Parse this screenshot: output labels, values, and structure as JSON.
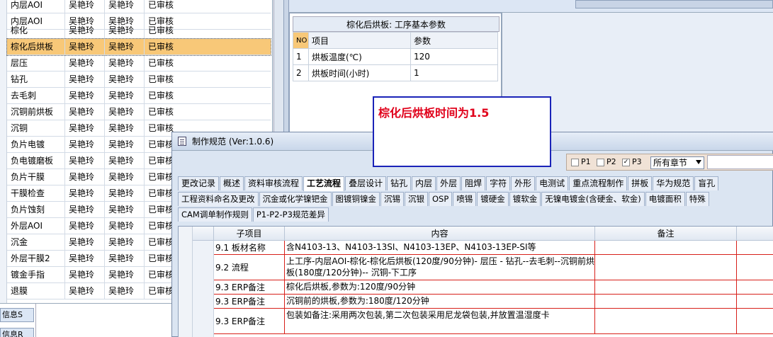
{
  "left_list": {
    "rows": [
      {
        "name": "内层AOI",
        "c1": "吴艳玲",
        "c2": "吴艳玲",
        "status": "已审核"
      },
      {
        "name": "棕化",
        "c1": "吴艳玲",
        "c2": "吴艳玲",
        "status": "已审核"
      },
      {
        "name": "棕化后烘板",
        "c1": "吴艳玲",
        "c2": "吴艳玲",
        "status": "已审核"
      },
      {
        "name": "层压",
        "c1": "吴艳玲",
        "c2": "吴艳玲",
        "status": "已审核"
      },
      {
        "name": "钻孔",
        "c1": "吴艳玲",
        "c2": "吴艳玲",
        "status": "已审核"
      },
      {
        "name": "去毛刺",
        "c1": "吴艳玲",
        "c2": "吴艳玲",
        "status": "已审核"
      },
      {
        "name": "沉铜前烘板",
        "c1": "吴艳玲",
        "c2": "吴艳玲",
        "status": "已审核"
      },
      {
        "name": "沉铜",
        "c1": "吴艳玲",
        "c2": "吴艳玲",
        "status": "已审核"
      },
      {
        "name": "负片电镀",
        "c1": "吴艳玲",
        "c2": "吴艳玲",
        "status": "已审核"
      },
      {
        "name": "负电镀磨板",
        "c1": "吴艳玲",
        "c2": "吴艳玲",
        "status": "已审核"
      },
      {
        "name": "负片干膜",
        "c1": "吴艳玲",
        "c2": "吴艳玲",
        "status": "已审核"
      },
      {
        "name": "干膜检查",
        "c1": "吴艳玲",
        "c2": "吴艳玲",
        "status": "已审核"
      },
      {
        "name": "负片蚀刻",
        "c1": "吴艳玲",
        "c2": "吴艳玲",
        "status": "已审核"
      },
      {
        "name": "外层AOI",
        "c1": "吴艳玲",
        "c2": "吴艳玲",
        "status": "已审核"
      },
      {
        "name": "沉金",
        "c1": "吴艳玲",
        "c2": "吴艳玲",
        "status": "已审核"
      },
      {
        "name": "外层干膜2",
        "c1": "吴艳玲",
        "c2": "吴艳玲",
        "status": "已审核"
      },
      {
        "name": "镀金手指",
        "c1": "吴艳玲",
        "c2": "吴艳玲",
        "status": "已审核"
      },
      {
        "name": "退膜",
        "c1": "吴艳玲",
        "c2": "吴艳玲",
        "status": "已审核"
      }
    ]
  },
  "bottom_left_tabs": [
    "信息S",
    "信息R"
  ],
  "param_panel": {
    "title": "棕化后烘板: 工序基本参数",
    "headers": {
      "no": "NO",
      "item": "项目",
      "value": "参数"
    },
    "rows": [
      {
        "no": "1",
        "item": "烘板温度(℃)",
        "value": "120"
      },
      {
        "no": "2",
        "item": "烘板时间(小时)",
        "value": "1"
      }
    ]
  },
  "note": {
    "text": "棕化后烘板时间为1.5"
  },
  "spec_window": {
    "title": "制作规范 (Ver:1.0.6)",
    "filters": {
      "p1": "P1",
      "p2": "P2",
      "p3": "P3",
      "p3_checked": "✓",
      "chapter": "所有章节"
    },
    "tabs_row1": [
      "更改记录",
      "概述",
      "资料审核流程",
      "工艺流程",
      "叠层设计",
      "钻孔",
      "内层",
      "外层",
      "阻焊",
      "字符",
      "外形",
      "电测试",
      "重点流程制作",
      "拼板",
      "华为规范",
      "盲孔"
    ],
    "tabs_row2": [
      "工程资料命名及更改",
      "沉金或化学镍钯金",
      "图镀铜镍金",
      "沉锡",
      "沉银",
      "OSP",
      "喷锡",
      "镀硬金",
      "镀软金",
      "无镍电镀金(含硬金、软金)",
      "电镀面积",
      "特殊"
    ],
    "tabs_row3": [
      "CAM调单制作规则",
      "P1-P2-P3规范差异"
    ],
    "grid": {
      "headers": {
        "sub": "子项目",
        "content": "内容",
        "remark": "备注"
      },
      "rows": [
        {
          "sub": "9.1 板材名称",
          "content": "含N4103-13、N4103-13SI、N4103-13EP、N4103-13EP-SI等"
        },
        {
          "sub": "9.2 流程",
          "content": "上工序-内层AOI-棕化-棕化后烘板(120度/90分钟)- 层压 - 钻孔--去毛刺--沉铜前烘板(180度/120分钟)-- 沉铜-下工序"
        },
        {
          "sub": "9.3 ERP备注",
          "content": "棕化后烘板,参数为:120度/90分钟"
        },
        {
          "sub": "9.3 ERP备注",
          "content": "沉铜前的烘板,参数为:180度/120分钟"
        },
        {
          "sub": "9.3 ERP备注",
          "content": "包装如备注:采用两次包装,第二次包装采用尼龙袋包装,并放置温湿度卡"
        }
      ]
    }
  },
  "colors": {
    "selected_row": "#f8c878",
    "note_border": "#1a23b8",
    "note_text": "#e0001a",
    "grid_line": "#d8201a"
  }
}
